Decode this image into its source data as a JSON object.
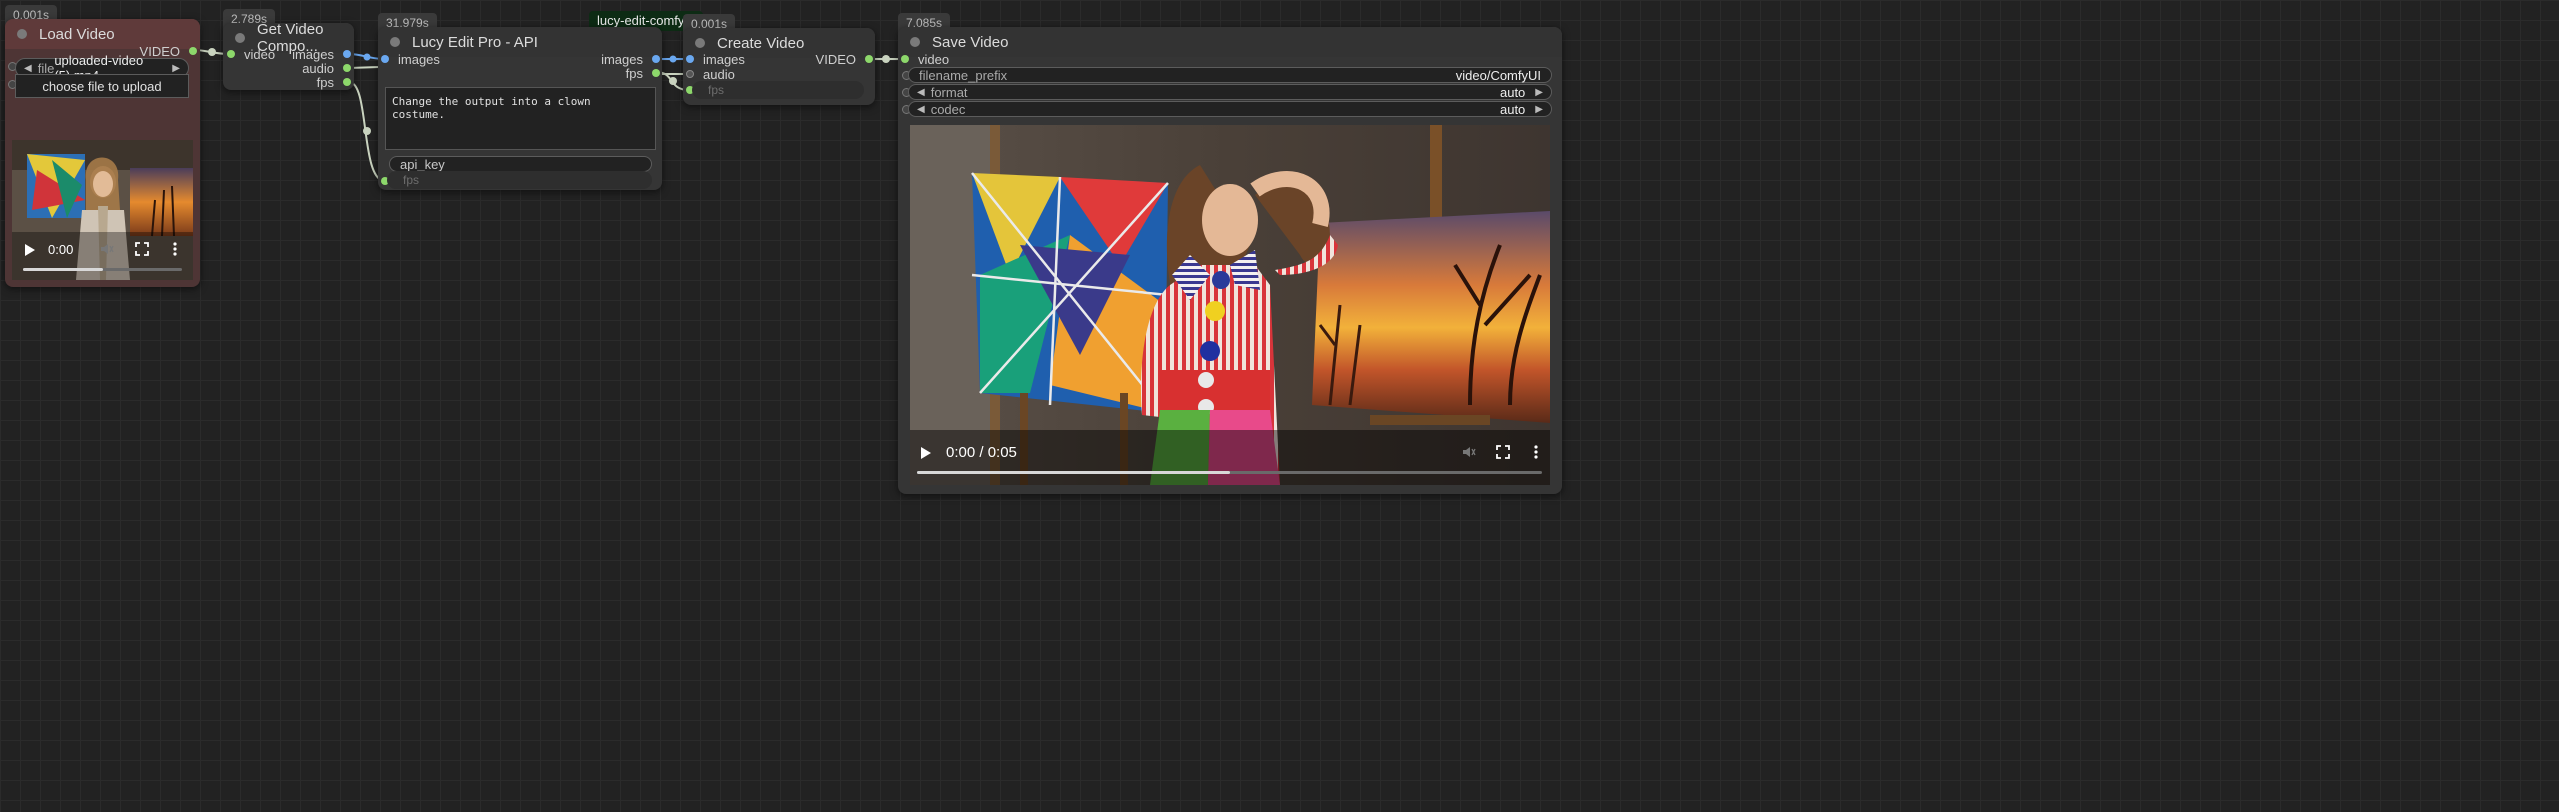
{
  "nodes": {
    "load_video": {
      "time": "0.001s",
      "title": "Load Video",
      "outputs": [
        "VIDEO"
      ],
      "file_label": "file",
      "file_value": "uploaded-video (5).mp4",
      "upload_label": "choose file to upload",
      "player": {
        "time": "0:00",
        "progress": 0.5
      }
    },
    "get_video_components": {
      "time": "2.789s",
      "title": "Get Video Compo...",
      "inputs": [
        "video"
      ],
      "outputs": [
        "images",
        "audio",
        "fps"
      ]
    },
    "lucy_edit": {
      "time": "31.979s",
      "tag": "lucy-edit-comfyui",
      "title": "Lucy Edit Pro - API",
      "inputs": [
        "images"
      ],
      "outputs": [
        "images",
        "fps"
      ],
      "prompt": "Change the output into a clown costume.",
      "api_key_label": "api_key",
      "fps_label": "fps"
    },
    "create_video": {
      "time": "0.001s",
      "title": "Create Video",
      "inputs": [
        "images",
        "audio",
        "fps"
      ],
      "outputs": [
        "VIDEO"
      ]
    },
    "save_video": {
      "time": "7.085s",
      "title": "Save Video",
      "inputs": [
        "video"
      ],
      "filename_prefix_label": "filename_prefix",
      "filename_prefix_value": "video/ComfyUI",
      "format_label": "format",
      "format_value": "auto",
      "codec_label": "codec",
      "codec_value": "auto",
      "player": {
        "time": "0:00 / 0:05",
        "progress": 0.5
      }
    }
  },
  "colors": {
    "canvas": "#222222",
    "node": "#353535",
    "load_node": "#4e3535",
    "pin_video": "#8dd86b",
    "pin_image": "#6aa8f0",
    "tag_bg": "#0d2b14"
  },
  "icons": [
    "play-icon",
    "volume-icon",
    "fullscreen-icon",
    "more-options-icon",
    "arrow-left-icon",
    "arrow-right-icon"
  ]
}
